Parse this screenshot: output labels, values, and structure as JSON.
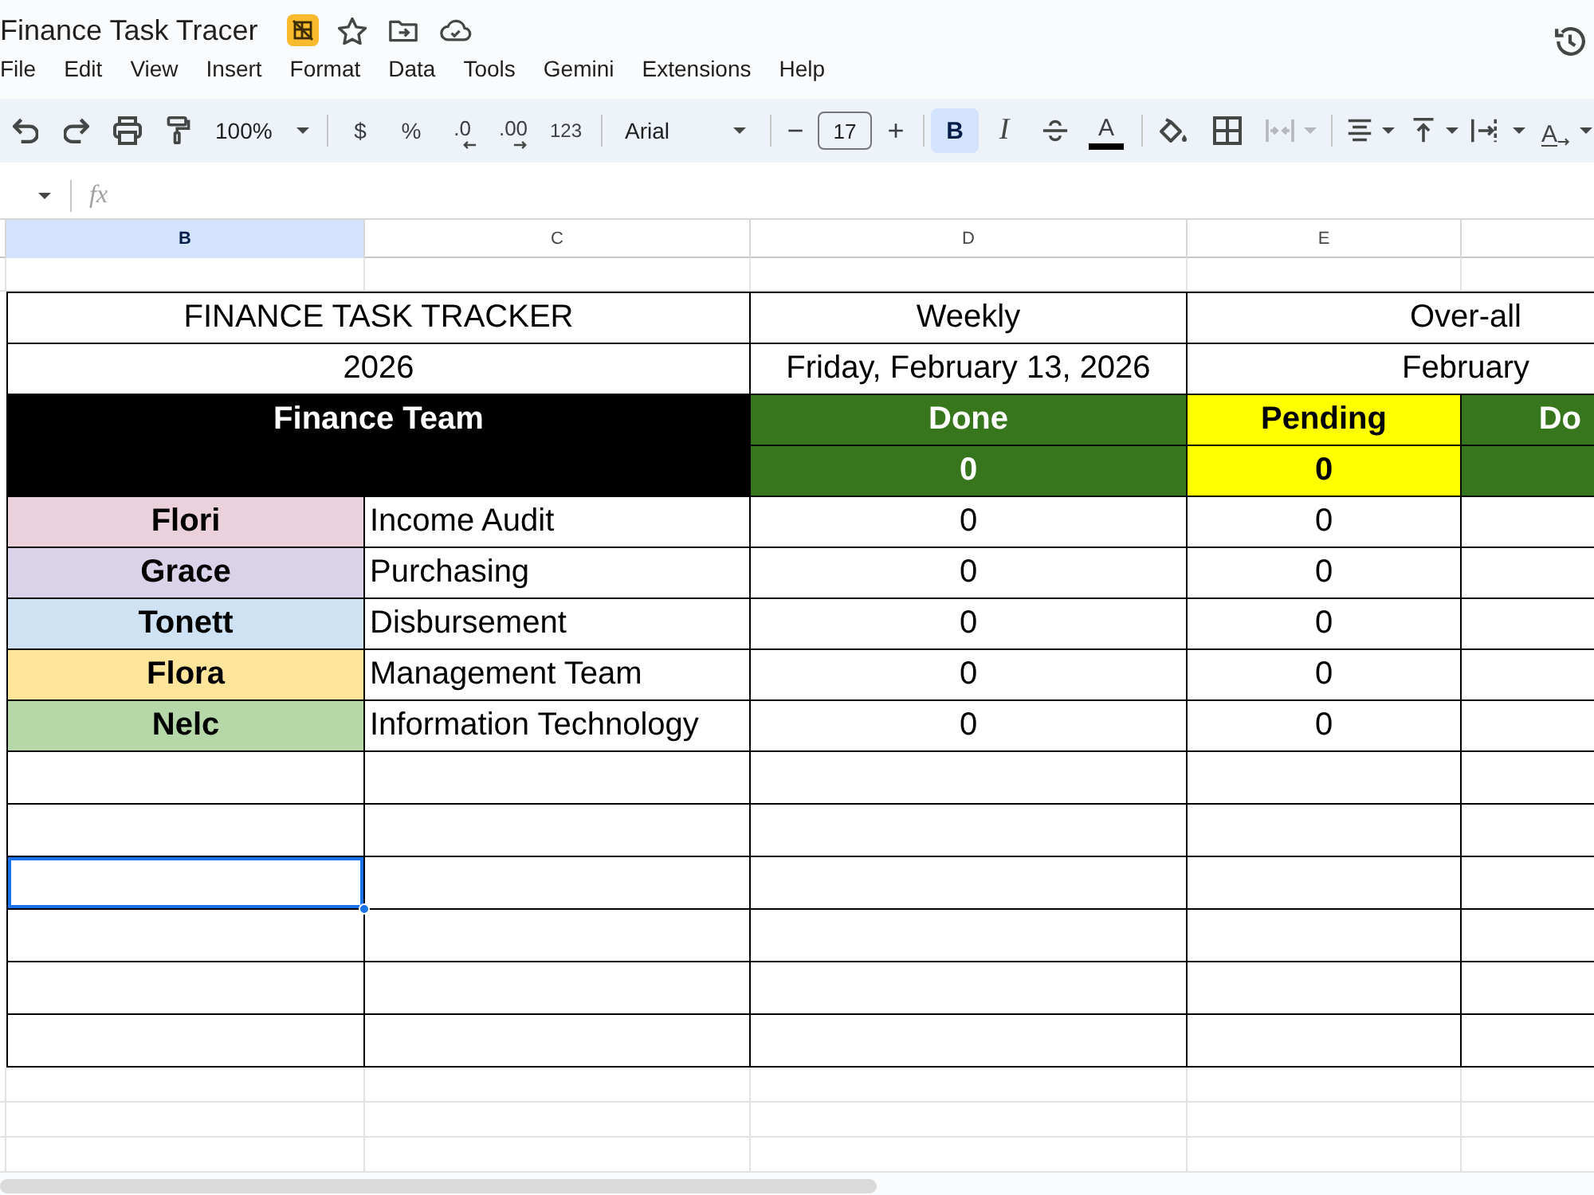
{
  "document": {
    "title": "Finance Task Tracer"
  },
  "menu": [
    "File",
    "Edit",
    "View",
    "Insert",
    "Format",
    "Data",
    "Tools",
    "Gemini",
    "Extensions",
    "Help"
  ],
  "toolbar": {
    "zoom": "100%",
    "currency": "$",
    "percent": "%",
    "decrease_decimal": ".0",
    "increase_decimal": ".00",
    "number_format": "123",
    "font": "Arial",
    "font_size_decrease": "−",
    "font_size": "17",
    "font_size_increase": "+",
    "bold": {
      "label": "B",
      "selected": true
    },
    "italic": {
      "label": "I",
      "selected": false
    },
    "strikethrough": {
      "selected": false
    },
    "text_color": "A",
    "merge": {
      "disabled": true
    },
    "text_rotation": "A"
  },
  "formula_bar": {
    "label": "fx"
  },
  "column_headers": [
    {
      "label": "B",
      "selected": true
    },
    {
      "label": "C",
      "selected": false
    },
    {
      "label": "D",
      "selected": false
    },
    {
      "label": "E",
      "selected": false
    }
  ],
  "sheet": {
    "title": "FINANCE TASK TRACKER",
    "weekly_label": "Weekly",
    "overall_label": "Over-all",
    "year": "2026",
    "date": "Friday, February 13, 2026",
    "month": "February",
    "team_header": "Finance Team",
    "status_columns": [
      {
        "label": "Done",
        "color": "#38761d",
        "total": "0"
      },
      {
        "label": "Pending",
        "color": "#ffff00",
        "total": "0"
      },
      {
        "label": "Do",
        "color": "#38761d"
      }
    ],
    "members": [
      {
        "name": "Flori",
        "color": "#ead1dc",
        "department": "Income Audit",
        "counts": [
          "0",
          "0"
        ]
      },
      {
        "name": "Grace",
        "color": "#d9d2e9",
        "department": "Purchasing",
        "counts": [
          "0",
          "0"
        ]
      },
      {
        "name": "Tonett",
        "color": "#cfe2f3",
        "department": "Disbursement",
        "counts": [
          "0",
          "0"
        ]
      },
      {
        "name": "Flora",
        "color": "#ffe599",
        "department": "Management Team",
        "counts": [
          "0",
          "0"
        ]
      },
      {
        "name": "Nelc",
        "color": "#b6d7a8",
        "department": "Information Technology",
        "counts": [
          "0",
          "0"
        ]
      }
    ],
    "blank_rows": [
      {
        "selected": false
      },
      {
        "selected": false
      },
      {
        "selected": true
      },
      {
        "selected": false
      },
      {
        "selected": false
      },
      {
        "selected": false
      }
    ]
  }
}
